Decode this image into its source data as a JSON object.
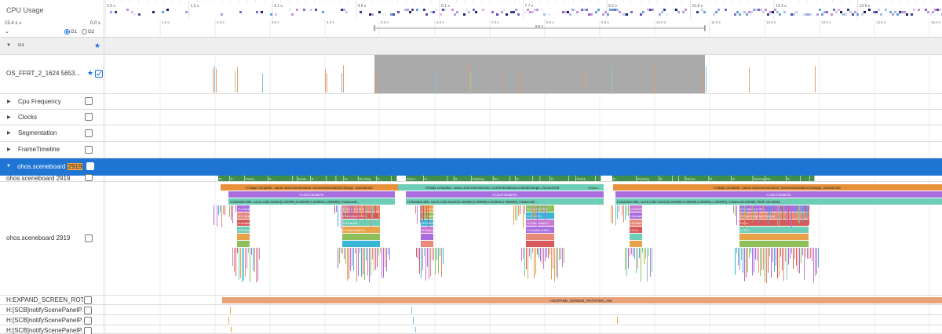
{
  "header": {
    "cpu_title": "CPU Usage",
    "range_start": "15.4 s »",
    "range_end": "0.0 s",
    "caret": "⌄",
    "radio_g1": "G1",
    "radio_g2": "G2",
    "overview_ticks": [
      "0.0 s",
      "1.5 s",
      "3.1 s",
      "4.6 s",
      "6.1 s",
      "7.7 s",
      "9.2 s",
      "10.8 s",
      "12.3 s",
      "13.8 s"
    ],
    "ruler_ticks": [
      "",
      "1.0 s",
      "2.0 s",
      "3.0 s",
      "4.0 s",
      "5.0 s",
      "6.0 s",
      "7.0 s",
      "8.0 s",
      "9.0 s",
      "10.0 s",
      "11.0 s",
      "12.0 s",
      "13.0 s",
      "14.0 s",
      "15.0 s"
    ],
    "selection_duration": "6.0 s"
  },
  "rows": {
    "g1": {
      "label": "G1"
    },
    "ffrt": {
      "label": "OS_FFRT_2_1624 5653..."
    },
    "cpu_frequency": {
      "label": "Cpu Frequency"
    },
    "clocks": {
      "label": "Clocks"
    },
    "segmentation": {
      "label": "Segmentation"
    },
    "frame_timeline": {
      "label": "FrameTimeline"
    },
    "process": {
      "label": "ohos.sceneboard",
      "pid": "2919"
    },
    "thread1": {
      "label": "ohos.sceneboard 2919"
    },
    "thread2": {
      "label": "ohos.sceneboard 2919"
    },
    "expand": {
      "label": "H:EXPAND_SCREEN_ROTATI..."
    },
    "scb1": {
      "label": "H:[SCB]notifyScenePanelP..."
    },
    "scb2": {
      "label": "H:[SCB]notifyScenePanelP..."
    },
    "scb3": {
      "label": "H:[SCB]notifyScenePanelP..."
    }
  },
  "slices": {
    "napi1": "H:Napi complete. name:JsScreenSession::screenOrientationChange, traceid:0x0",
    "napi2": "H:Napi complete. name:JsScreenSession::screenRotationLockedChange, traceid:0x0",
    "napi_short": "H:Sym...",
    "napi3": "H:Napi complete. name:JsScreenSession::screenOrientationChange, traceid:0x0",
    "js1": "H:JSAnimateTo",
    "js2": "H:JSAnimateTo",
    "js3": "H:JSAnimateTo",
    "dur1": "H:duration:600, curve:cubic-bezier(0.200000,0.000000,0.200000,1.000000); instanceId...",
    "dur2": "H:duration:600, curve:cubic-bezier(0.200000,0.000000,0.200000,1.000000); instanceId:...",
    "dur3": "H:duration:600, curve:cubic-bezier(0.200000,0.000000,0.200000,1.000000); instanceId:100000, finish cnt:30311",
    "running": [
      "R...",
      "R...",
      "Runni...",
      "R...",
      "Runni...",
      "R...",
      "R...",
      "Running",
      "R...",
      "Runni...",
      "R...",
      "R...",
      "Running",
      "Ru...",
      "R...",
      "R...",
      "Runni...",
      "R...",
      "Running",
      "R...",
      "Runni...",
      "R...",
      "R...",
      "Running",
      "Ru...",
      "R...",
      "Runni...",
      "R...",
      "Running",
      "Runni...",
      "Running"
    ],
    "sub_labels": [
      "H:JSAnimateTo",
      "H:JSAnimateTo",
      "H:duration:1000...",
      "H:FlushDir...",
      "H:JSAnimateTo",
      "H:duration:600...",
      "H:FlushDi...",
      "H:JSAnimateTo",
      "H:duration:1000...",
      "H:FlushDirtyNodeUpdate",
      "H:Cu...",
      "H:JSV..."
    ],
    "expand_slice": "H:EXPAND_SCREEN_ROTATION_ANI"
  },
  "colors": {
    "accent_blue": "#1e75d4",
    "pid_highlight": "#f3a342",
    "selection_gray": "#aaaaaa",
    "napi_orange": "#e8913d",
    "napi_teal": "#6dcdb6",
    "js_purple": "#a86ee0",
    "running_green": "#3f8f4a",
    "expand_orange": "#e7a27a"
  }
}
